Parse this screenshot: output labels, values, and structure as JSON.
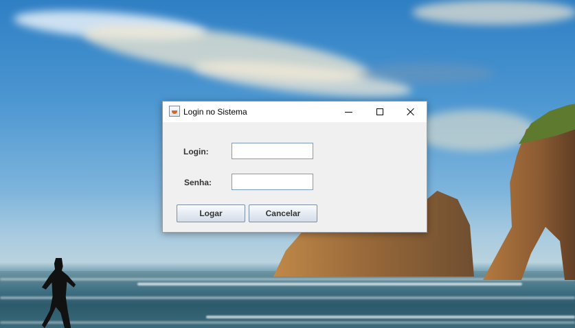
{
  "window": {
    "title": "Login no Sistema",
    "icon": "java-cup-icon"
  },
  "form": {
    "login_label": "Login:",
    "login_value": "",
    "password_label": "Senha:",
    "password_value": ""
  },
  "buttons": {
    "login": "Logar",
    "cancel": "Cancelar"
  }
}
